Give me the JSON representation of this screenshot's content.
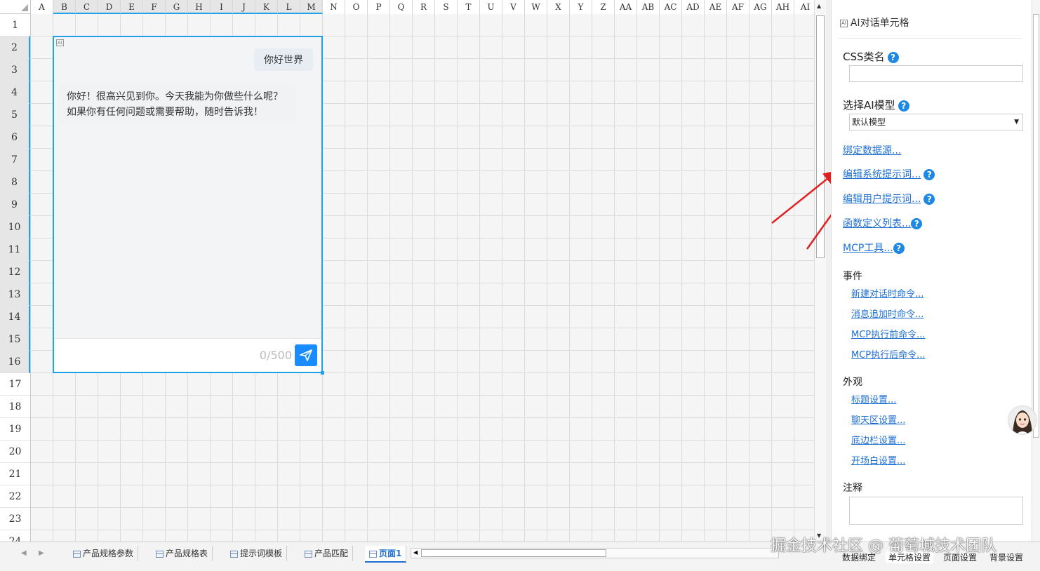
{
  "columns": [
    "A",
    "B",
    "C",
    "D",
    "E",
    "F",
    "G",
    "H",
    "I",
    "J",
    "K",
    "L",
    "M",
    "N",
    "O",
    "P",
    "Q",
    "R",
    "S",
    "T",
    "U",
    "V",
    "W",
    "X",
    "Y",
    "Z",
    "AA",
    "AB",
    "AC",
    "AD",
    "AE",
    "AF",
    "AG",
    "AH",
    "AI"
  ],
  "rows": [
    "1",
    "2",
    "3",
    "4",
    "5",
    "6",
    "7",
    "8",
    "9",
    "10",
    "11",
    "12",
    "13",
    "14",
    "15",
    "16",
    "17",
    "18",
    "19",
    "20",
    "21",
    "22",
    "23",
    "24"
  ],
  "chat": {
    "ai_tag": "AI",
    "user_message": "你好世界",
    "ai_message": "你好！很高兴见到你。今天我能为你做些什么呢？如果你有任何问题或需要帮助，随时告诉我！",
    "counter": "0/500",
    "send_icon": "send-icon"
  },
  "panel": {
    "title": "AI对话单元格",
    "css_label": "CSS类名",
    "css_value": "",
    "model_label": "选择AI模型",
    "model_value": "默认模型",
    "bind_datasource": "绑定数据源...",
    "edit_system_prompt": "编辑系统提示词...",
    "edit_user_prompt": "编辑用户提示词...",
    "function_list": "函数定义列表...",
    "mcp_tools": "MCP工具...",
    "events_label": "事件",
    "events": [
      "新建对话时命令...",
      "消息追加时命令...",
      "MCP执行前命令...",
      "MCP执行后命令..."
    ],
    "appearance_label": "外观",
    "appearance": [
      "标题设置...",
      "聊天区设置...",
      "底边栏设置...",
      "开场白设置..."
    ],
    "note_label": "注释",
    "bottom_tabs": [
      "数据绑定",
      "单元格设置",
      "页面设置",
      "背景设置"
    ]
  },
  "sheets": [
    "产品规格参数",
    "产品规格表",
    "提示词模板",
    "产品匹配",
    "页面1"
  ],
  "watermark": "掘金技术社区 @ 葡萄城技术团队",
  "colors": {
    "accent": "#21a1e8",
    "link": "#1d6fd1",
    "send": "#1a8cff",
    "arrow": "#e02020"
  }
}
